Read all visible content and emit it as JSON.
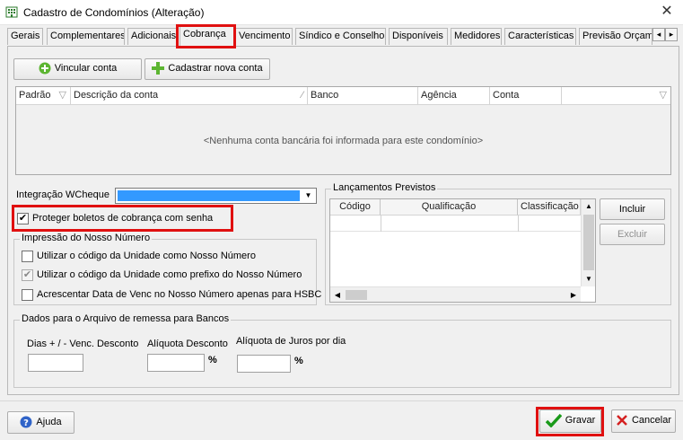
{
  "window": {
    "title": "Cadastro de Condomínios (Alteração)",
    "app_icon": "building-icon",
    "close_icon": "close-icon"
  },
  "tabs": [
    {
      "label": "Gerais"
    },
    {
      "label": "Complementares"
    },
    {
      "label": "Adicionais"
    },
    {
      "label": "Cobrança",
      "active": true
    },
    {
      "label": "Vencimento"
    },
    {
      "label": "Síndico e Conselho"
    },
    {
      "label": "Disponíveis"
    },
    {
      "label": "Medidores"
    },
    {
      "label": "Características"
    },
    {
      "label": "Previsão Orçam"
    }
  ],
  "tab_scroll": {
    "left": "◂",
    "right": "▸"
  },
  "accounts": {
    "link_button": "Vincular conta",
    "new_button": "Cadastrar nova conta",
    "columns": [
      "Padrão",
      "Descrição da conta",
      "Banco",
      "Agência",
      "Conta"
    ],
    "empty_message": "<Nenhuma conta bancária foi informada para este condomínio>"
  },
  "integration": {
    "label": "Integração WCheque",
    "value": ""
  },
  "protect_boletos": {
    "label": "Proteger boletos de cobrança com senha",
    "checked": true,
    "mark": "✔"
  },
  "nosso_numero": {
    "title": "Impressão do Nosso Número",
    "options": [
      {
        "label": "Utilizar o código da Unidade como Nosso Número",
        "checked": false,
        "mark": ""
      },
      {
        "label": "Utilizar o código da Unidade como prefixo do Nosso Número",
        "checked": true,
        "mark": "✔"
      },
      {
        "label": "Acrescentar Data de Venc no Nosso Número apenas para HSBC",
        "checked": false,
        "mark": ""
      }
    ]
  },
  "lancamentos": {
    "title": "Lançamentos Previstos",
    "columns": [
      "Código",
      "Qualificação",
      "Classificação"
    ],
    "include_button": "Incluir",
    "exclude_button": "Excluir"
  },
  "remessa": {
    "title": "Dados para o Arquivo de remessa para Bancos",
    "dias_label": "Dias + / - Venc. Desconto",
    "aliquota_desconto_label": "Alíquota Desconto",
    "aliquota_juros_label": "Alíquota de Juros por dia",
    "percent": "%",
    "dias_value": "",
    "aliquota_desconto_value": "",
    "aliquota_juros_value": ""
  },
  "footer": {
    "help_button": "Ajuda",
    "save_button": "Gravar",
    "cancel_button": "Cancelar"
  },
  "colors": {
    "highlight_red": "#e01010",
    "combo_selection": "#3399ff",
    "save_check": "#1a9a1a",
    "cancel_x": "#d42020",
    "add_icon": "#5cb531"
  }
}
